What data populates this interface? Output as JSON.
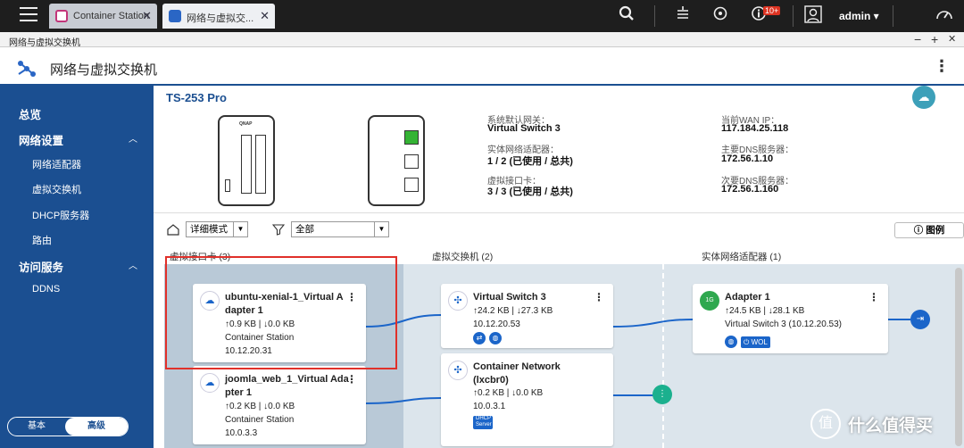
{
  "tabs": [
    {
      "label": "Container Station"
    },
    {
      "label": "网络与虚拟交..."
    }
  ],
  "topbar": {
    "badge": "10+",
    "user": "admin"
  },
  "window": {
    "title": "网络与虚拟交换机",
    "min": "−",
    "max": "+",
    "close": "✕"
  },
  "app": {
    "title": "网络与虚拟交换机"
  },
  "sidebar": {
    "items": [
      {
        "label": "总览"
      },
      {
        "label": "网络设置"
      },
      {
        "label": "网络适配器"
      },
      {
        "label": "虚拟交换机"
      },
      {
        "label": "DHCP服务器"
      },
      {
        "label": "路由"
      },
      {
        "label": "访问服务"
      },
      {
        "label": "DDNS"
      }
    ],
    "mode_basic": "基本",
    "mode_advanced": "高级"
  },
  "nas": {
    "model": "TS-253 Pro",
    "default_gw_label": "系统默认网关：",
    "default_gw": "Virtual Switch 3",
    "phys_label": "实体网络适配器：",
    "phys": "1 / 2 (已使用 / 总共)",
    "vnic_label": "虚拟接口卡：",
    "vnic": "3 / 3 (已使用 / 总共)",
    "wan_label": "当前WAN IP：",
    "wan": "117.184.25.118",
    "dns1_label": "主要DNS服务器：",
    "dns1": "172.56.1.10",
    "dns2_label": "次要DNS服务器：",
    "dns2": "172.56.1.160"
  },
  "controls": {
    "view_mode": "详细模式",
    "filter": "全部",
    "legend": "图例"
  },
  "columns": {
    "vnic": "虚拟接口卡 (3)",
    "vswitch": "虚拟交换机 (2)",
    "adapter": "实体网络适配器 (1)"
  },
  "cards": {
    "vnic1": {
      "name1": "ubuntu-xenial-1_Virtual A",
      "name2": "dapter 1",
      "traffic": "↑0.9 KB | ↓0.0 KB",
      "app": "Container Station",
      "ip": "10.12.20.31"
    },
    "vnic2": {
      "name1": "joomla_web_1_Virtual Ada",
      "name2": "pter 1",
      "traffic": "↑0.2 KB | ↓0.0 KB",
      "app": "Container Station",
      "ip": "10.0.3.3"
    },
    "vs1": {
      "name": "Virtual Switch 3",
      "traffic": "↑24.2 KB | ↓27.3 KB",
      "ip": "10.12.20.53"
    },
    "vs2": {
      "name1": "Container Network",
      "name2": "(lxcbr0)",
      "traffic": "↑0.2 KB | ↓0.0 KB",
      "ip": "10.0.3.1",
      "dhcp": "DHCP Server"
    },
    "ad1": {
      "name": "Adapter 1",
      "traffic": "↑24.5 KB | ↓28.1 KB",
      "vs": "Virtual Switch 3 (10.12.20.53)",
      "wol": "WOL",
      "speed": "1G"
    }
  },
  "watermark": "什么值得买",
  "colors": {
    "sidebar": "#1b4f91",
    "accent": "#1b65c9",
    "highlight": "#e0302a"
  }
}
